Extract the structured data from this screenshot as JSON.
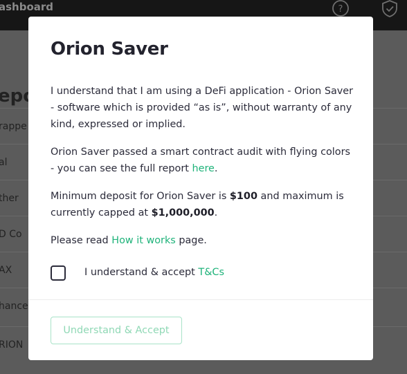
{
  "background": {
    "brand_label": "ashboard",
    "heading": "epo",
    "rows": [
      "rappe",
      "al",
      "ther",
      "D Co",
      "AX",
      "hance",
      "RION"
    ]
  },
  "modal": {
    "title": "Orion Saver",
    "p1": "I understand that I am using a DeFi application - Orion Saver - software which is provided “as is”, without warranty of any kind, expressed or implied.",
    "p2_text": "Orion Saver passed a smart contract audit with flying colors - you can see the full report ",
    "p2_link": "here",
    "p2_end": ".",
    "p3_pre": "Minimum deposit for Orion Saver is ",
    "p3_min": "$100",
    "p3_mid": " and maximum is currently capped at ",
    "p3_max": "$1,000,000",
    "p3_end": ".",
    "p4_pre": "Please read ",
    "p4_link": "How it works",
    "p4_post": " page.",
    "checkbox_label": "I understand & accept ",
    "checkbox_link": "T&Cs",
    "checkbox_checked": false,
    "accept_button": "Understand & Accept"
  },
  "colors": {
    "accent": "#1fb37a",
    "overlay": "#5b5b5b"
  }
}
